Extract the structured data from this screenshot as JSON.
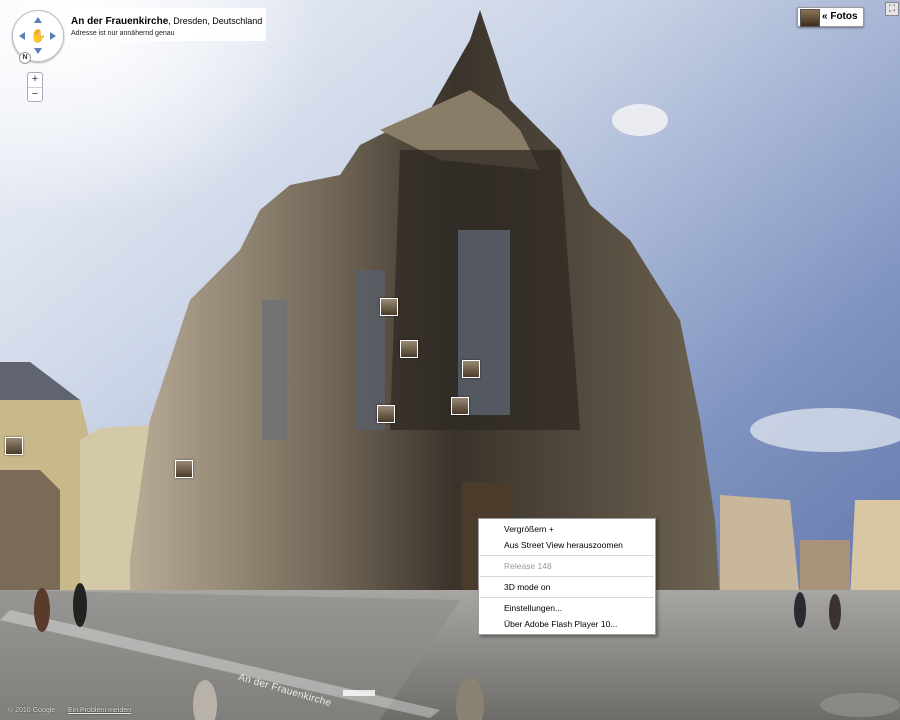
{
  "address": {
    "title": "An der Frauenkirche",
    "location": ", Dresden, Deutschland",
    "note": "Adresse ist nur annähernd genau"
  },
  "navigation": {
    "north_label": "N",
    "zoom_in": "+",
    "zoom_out": "−"
  },
  "fotos_button": {
    "label": "« Fotos"
  },
  "fullscreen_button": {
    "label": "⛶"
  },
  "context_menu": {
    "items": [
      {
        "label": "Vergrößern +",
        "enabled": true
      },
      {
        "label": "Aus Street View herauszoomen",
        "enabled": true
      },
      {
        "label": "Release 148",
        "enabled": false
      },
      {
        "label": "3D mode on",
        "enabled": true
      },
      {
        "label": "Einstellungen...",
        "enabled": true
      },
      {
        "label": "Über Adobe Flash Player 10...",
        "enabled": true
      }
    ]
  },
  "street_label": "An der Frauenkirche",
  "footer": {
    "copyright": "© 2010 Google",
    "report": "Ein Problem melden"
  },
  "colors": {
    "sky": "#7a8fb5",
    "nav_arrow": "#5b7fb8",
    "stone_dark": "#3a342c",
    "stone_light": "#b9a98f"
  }
}
